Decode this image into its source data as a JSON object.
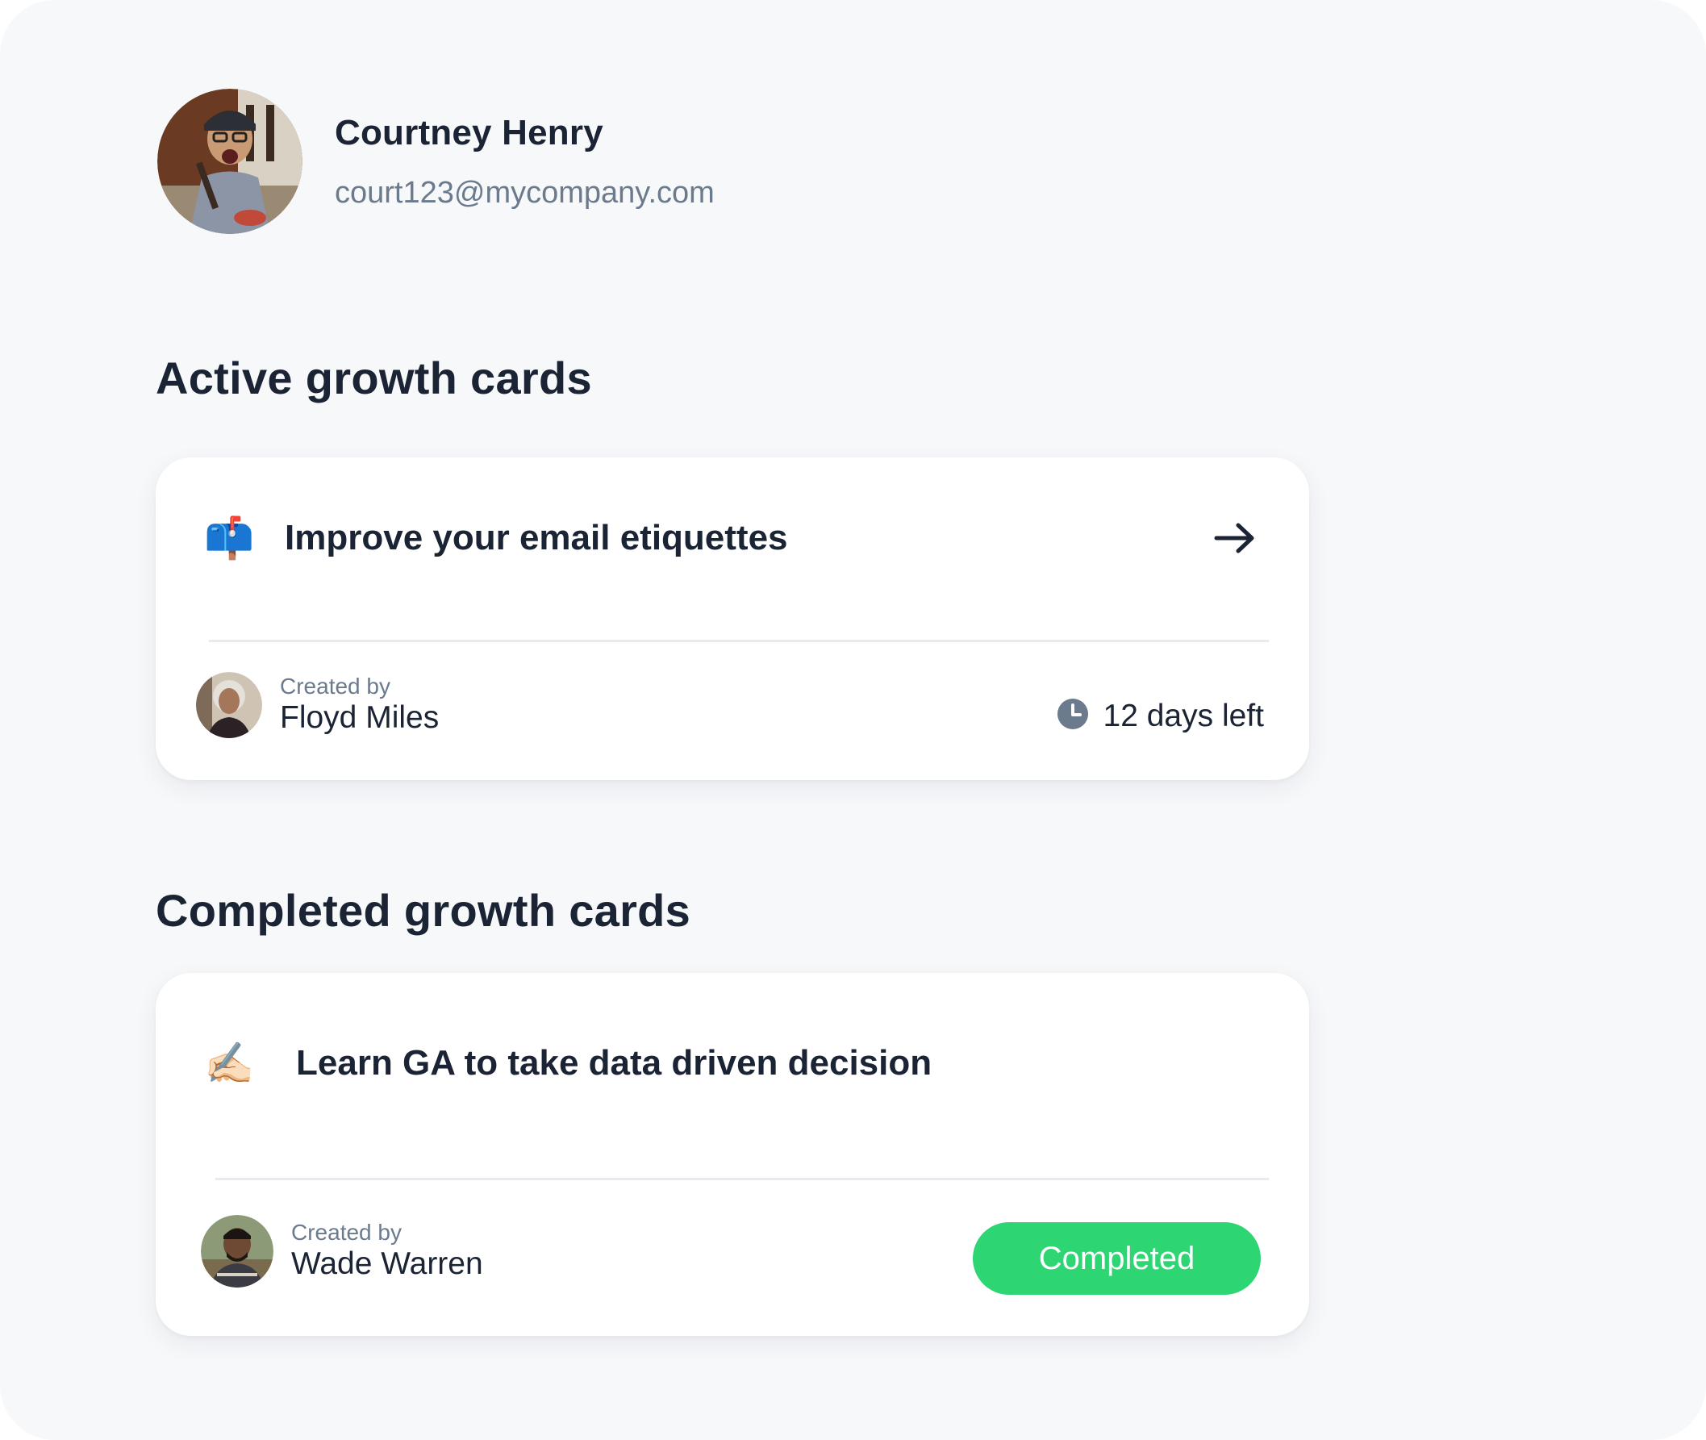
{
  "profile": {
    "name": "Courtney Henry",
    "email": "court123@mycompany.com"
  },
  "sections": {
    "active_title": "Active growth cards",
    "completed_title": "Completed growth cards"
  },
  "active_card": {
    "emoji": "📫",
    "title": "Improve your email etiquettes",
    "created_by_caption": "Created by",
    "creator_name": "Floyd Miles",
    "time_left": "12 days left",
    "icons": {
      "emoji": "mailbox-icon",
      "arrow": "arrow-right-icon",
      "clock": "clock-icon"
    }
  },
  "completed_card": {
    "emoji": "✍🏻",
    "title": "Learn GA to take data driven decision",
    "created_by_caption": "Created by",
    "creator_name": "Wade Warren",
    "status": "Completed",
    "icons": {
      "emoji": "writing-hand-icon"
    }
  },
  "colors": {
    "background": "#f7f8fa",
    "card": "#ffffff",
    "text_primary": "#1b2434",
    "text_secondary": "#6b7a8c",
    "completed_green": "#2ed573",
    "clock_gray": "#6b7a8c"
  }
}
